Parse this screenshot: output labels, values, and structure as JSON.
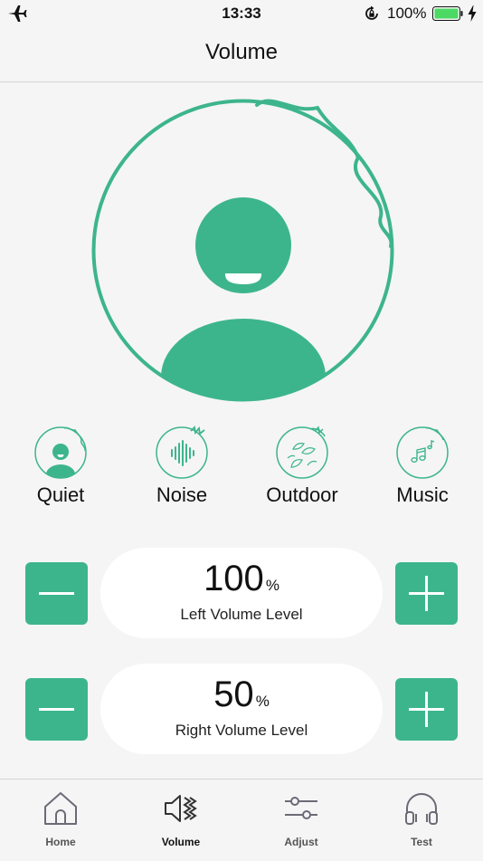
{
  "status_bar": {
    "time": "13:33",
    "battery_percent": "100%",
    "battery_level": 1.0,
    "icons": [
      "airplane-icon",
      "rotation-lock-icon",
      "battery-icon",
      "charging-icon"
    ]
  },
  "header": {
    "title": "Volume"
  },
  "colors": {
    "accent": "#3db58c",
    "background": "#f5f5f5",
    "tab_icon": "#6b6b78"
  },
  "modes": [
    {
      "label": "Quiet",
      "icon": "quiet-mode-icon"
    },
    {
      "label": "Noise",
      "icon": "noise-mode-icon"
    },
    {
      "label": "Outdoor",
      "icon": "outdoor-mode-icon"
    },
    {
      "label": "Music",
      "icon": "music-mode-icon"
    }
  ],
  "volume": {
    "left": {
      "value": "100",
      "unit": "%",
      "label": "Left Volume Level"
    },
    "right": {
      "value": "50",
      "unit": "%",
      "label": "Right Volume Level"
    }
  },
  "tabs": [
    {
      "label": "Home",
      "icon": "home-icon",
      "active": false
    },
    {
      "label": "Volume",
      "icon": "volume-icon",
      "active": true
    },
    {
      "label": "Adjust",
      "icon": "adjust-icon",
      "active": false
    },
    {
      "label": "Test",
      "icon": "headphones-icon",
      "active": false
    }
  ]
}
